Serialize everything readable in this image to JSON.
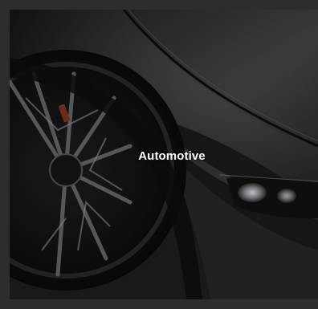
{
  "tile": {
    "label": "Automotive",
    "image_icon": "car-wheel-photo"
  },
  "colors": {
    "background": "#2c2d2e",
    "card": "#1b1c1e",
    "label": "#ffffff"
  }
}
